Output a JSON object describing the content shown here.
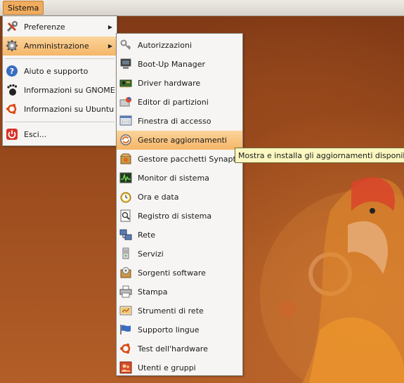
{
  "panel": {
    "menu_label": "Sistema"
  },
  "main_menu": {
    "items": [
      {
        "label": "Preferenze",
        "icon": "preferences-icon"
      },
      {
        "label": "Amministrazione",
        "icon": "administration-icon"
      },
      {
        "label": "Aiuto e supporto",
        "icon": "help-icon"
      },
      {
        "label": "Informazioni su GNOME",
        "icon": "gnome-foot-icon"
      },
      {
        "label": "Informazioni su Ubuntu",
        "icon": "ubuntu-logo-icon"
      },
      {
        "label": "Esci...",
        "icon": "power-icon"
      }
    ]
  },
  "admin_menu": {
    "items": [
      {
        "label": "Autorizzazioni",
        "icon": "keys-icon"
      },
      {
        "label": "Boot-Up Manager",
        "icon": "boot-manager-icon"
      },
      {
        "label": "Driver hardware",
        "icon": "hardware-driver-icon"
      },
      {
        "label": "Editor di partizioni",
        "icon": "partition-editor-icon"
      },
      {
        "label": "Finestra di accesso",
        "icon": "login-window-icon"
      },
      {
        "label": "Gestore aggiornamenti",
        "icon": "update-manager-icon"
      },
      {
        "label": "Gestore pacchetti Synaptic",
        "icon": "package-manager-icon"
      },
      {
        "label": "Monitor di sistema",
        "icon": "system-monitor-icon"
      },
      {
        "label": "Ora e data",
        "icon": "clock-icon"
      },
      {
        "label": "Registro di sistema",
        "icon": "system-log-icon"
      },
      {
        "label": "Rete",
        "icon": "network-icon"
      },
      {
        "label": "Servizi",
        "icon": "services-icon"
      },
      {
        "label": "Sorgenti software",
        "icon": "software-sources-icon"
      },
      {
        "label": "Stampa",
        "icon": "printer-icon"
      },
      {
        "label": "Strumenti di rete",
        "icon": "network-tools-icon"
      },
      {
        "label": "Supporto lingue",
        "icon": "language-support-icon"
      },
      {
        "label": "Test dell'hardware",
        "icon": "hardware-test-icon"
      },
      {
        "label": "Utenti e gruppi",
        "icon": "users-groups-icon"
      }
    ]
  },
  "tooltip": {
    "text": "Mostra e installa gli aggiornamenti disponibili"
  },
  "colors": {
    "highlight": "#f5b667",
    "menu_background": "#f6f5f3",
    "tooltip_background": "#fbf7c0",
    "desktop": "#9a4b1d"
  }
}
